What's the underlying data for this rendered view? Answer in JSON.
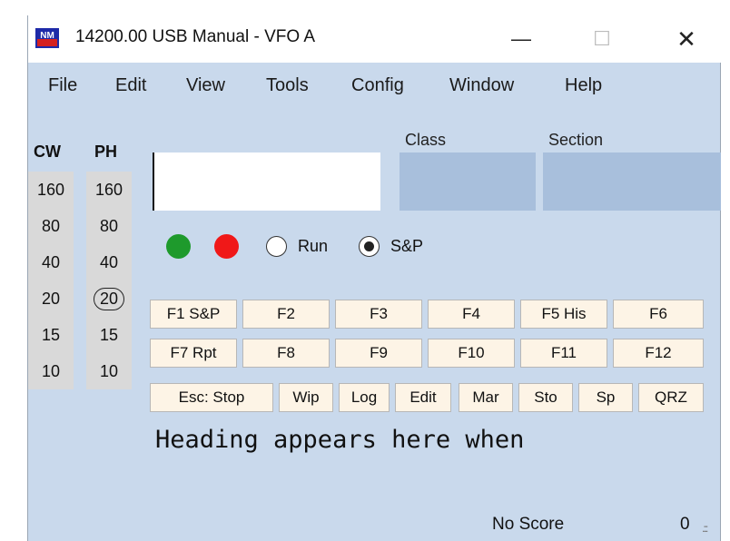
{
  "window": {
    "title": "14200.00 USB Manual - VFO A",
    "app_icon_text": "N1MM",
    "minimize_glyph": "—",
    "maximize_glyph": "☐",
    "close_glyph": "✕"
  },
  "menu": {
    "items": [
      "File",
      "Edit",
      "View",
      "Tools",
      "Config",
      "Window",
      "Help"
    ]
  },
  "bands": {
    "cw_header": "CW",
    "ph_header": "PH",
    "cw": [
      "160",
      "80",
      "40",
      "20",
      "15",
      "10"
    ],
    "ph": [
      "160",
      "80",
      "40",
      "20",
      "15",
      "10"
    ],
    "active_mode": "PH",
    "active_band": "20"
  },
  "entry": {
    "callsign_value": "",
    "class_label": "Class",
    "section_label": "Section"
  },
  "indicators": {
    "green_color": "#1e9a2c",
    "red_color": "#f01818"
  },
  "mode_radio": {
    "run_label": "Run",
    "sp_label": "S&P",
    "selected": "S&P"
  },
  "function_keys": {
    "row1": [
      "F1 S&P",
      "F2",
      "F3",
      "F4",
      "F5 His",
      "F6"
    ],
    "row2": [
      "F7 Rpt",
      "F8",
      "F9",
      "F10",
      "F11",
      "F12"
    ],
    "row3": [
      "Esc: Stop",
      "Wip",
      "Log",
      "Edit",
      "Mar",
      "Sto",
      "Sp",
      "QRZ"
    ]
  },
  "heading": "Heading appears here when",
  "status": {
    "score": "No Score",
    "count": "0"
  },
  "colors": {
    "background": "#c9d9ec",
    "field_box": "#a8bfdc",
    "fkey_bg": "#fdf4e6"
  }
}
